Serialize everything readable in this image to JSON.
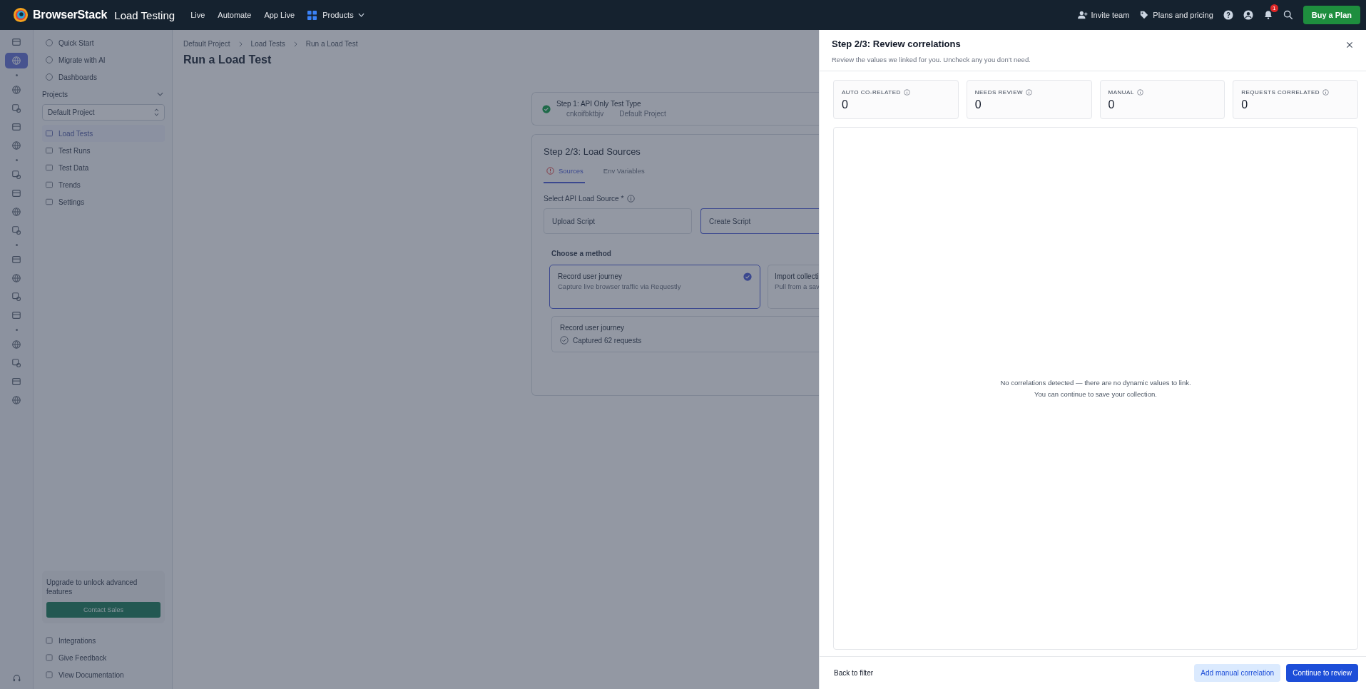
{
  "topbar": {
    "brand": "BrowserStack",
    "product": "Load Testing",
    "nav": [
      "Live",
      "Automate",
      "App Live",
      "Products"
    ],
    "invite": "Invite team",
    "plans": "Plans and pricing",
    "notification_count": "1",
    "buy": "Buy a Plan"
  },
  "rail": {
    "groups": [
      [
        {
          "selected": false
        },
        {
          "selected": true
        }
      ],
      [
        {
          "selected": false
        },
        {
          "selected": false
        },
        {
          "selected": false
        },
        {
          "selected": false
        }
      ],
      [
        {
          "selected": false
        },
        {
          "selected": false
        },
        {
          "selected": false
        },
        {
          "selected": false
        }
      ],
      [
        {
          "selected": false
        },
        {
          "selected": false
        },
        {
          "selected": false
        },
        {
          "selected": false
        }
      ],
      [
        {
          "selected": false
        },
        {
          "selected": false
        },
        {
          "selected": false
        },
        {
          "selected": false
        }
      ]
    ]
  },
  "sidebar": {
    "top_items": [
      "Quick Start",
      "Migrate with AI",
      "Dashboards"
    ],
    "projects_label": "Projects",
    "project_select": "Default Project",
    "project_items": [
      {
        "label": "Load Tests",
        "selected": true
      },
      {
        "label": "Test Runs",
        "selected": false
      },
      {
        "label": "Test Data",
        "selected": false
      },
      {
        "label": "Trends",
        "selected": false
      },
      {
        "label": "Settings",
        "selected": false
      }
    ],
    "upgrade_text": "Upgrade to unlock advanced features",
    "contact": "Contact Sales",
    "bottom_items": [
      "Integrations",
      "Give Feedback",
      "View Documentation"
    ]
  },
  "main": {
    "breadcrumbs": [
      "Default Project",
      "Load Tests",
      "Run a Load Test"
    ],
    "title": "Run a Load Test",
    "step1": {
      "title": "Step 1: API Only Test Type",
      "meta": [
        "cnkoifbktbjv",
        "Default Project"
      ]
    },
    "step2": {
      "title": "Step 2/3: Load Sources",
      "tabs": [
        {
          "label": "Sources",
          "selected": true
        },
        {
          "label": "Env Variables",
          "selected": false
        }
      ],
      "source_label": "Select API Load Source *",
      "sources": [
        {
          "label": "Upload Script",
          "selected": false
        },
        {
          "label": "Create Script",
          "selected": true
        }
      ],
      "method_label": "Choose a method",
      "methods": [
        {
          "title": "Record user journey",
          "desc": "Capture live browser traffic via Requestly",
          "selected": true
        },
        {
          "title": "Import collecti",
          "desc": "Pull from a sav",
          "selected": false
        }
      ],
      "recorded": {
        "title": "Record user journey",
        "status": "Captured 62 requests"
      }
    }
  },
  "panel": {
    "title": "Step 2/3: Review correlations",
    "subtitle": "Review the values we linked for you. Uncheck any you don’t need.",
    "stats": [
      {
        "label": "AUTO CO-RELATED",
        "value": "0"
      },
      {
        "label": "NEEDS REVIEW",
        "value": "0"
      },
      {
        "label": "MANUAL",
        "value": "0"
      },
      {
        "label": "REQUESTS CORRELATED",
        "value": "0"
      }
    ],
    "empty_message": "No correlations detected — there are no dynamic values to link. You can continue to save your collection.",
    "back": "Back to filter",
    "secondary_button": "Add manual correlation",
    "primary_button": "Continue to review"
  }
}
